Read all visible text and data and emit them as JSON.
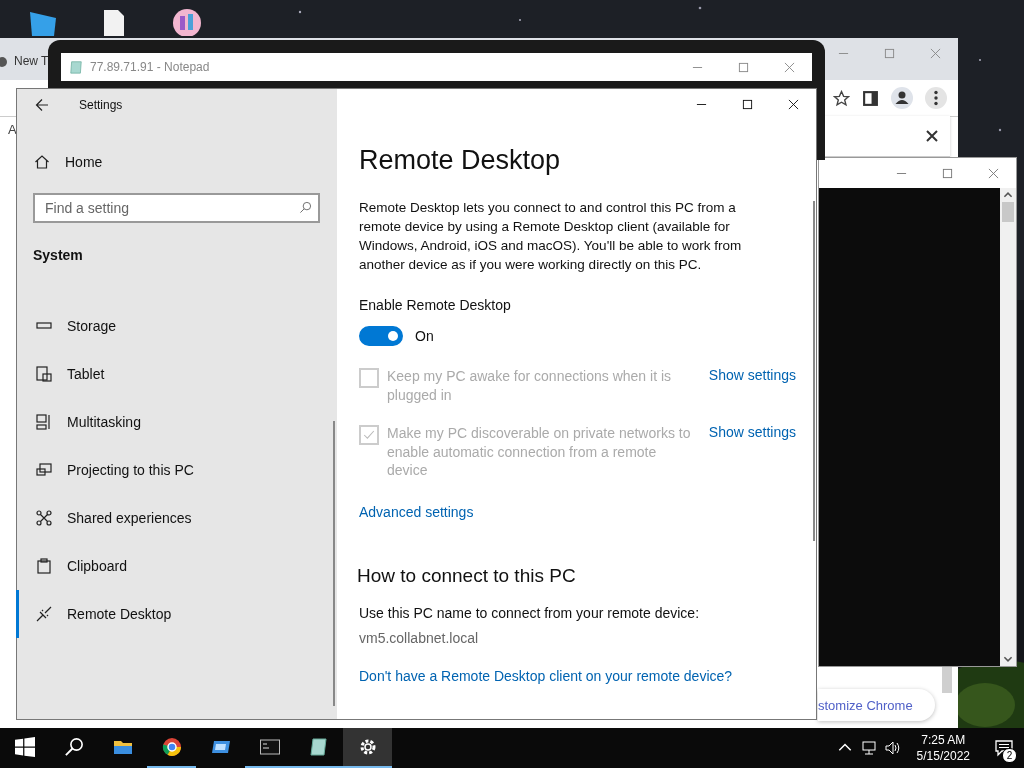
{
  "chrome_window": {
    "tab_title": "New T",
    "page_letter": "A",
    "customize_button": "stomize Chrome"
  },
  "notepad_window": {
    "title": "77.89.71.91 - Notepad"
  },
  "settings": {
    "title": "Settings",
    "home": "Home",
    "search": {
      "placeholder": "Find a setting"
    },
    "section": "System",
    "nav": [
      {
        "label": "Storage",
        "selected": false
      },
      {
        "label": "Tablet",
        "selected": false
      },
      {
        "label": "Multitasking",
        "selected": false
      },
      {
        "label": "Projecting to this PC",
        "selected": false
      },
      {
        "label": "Shared experiences",
        "selected": false
      },
      {
        "label": "Clipboard",
        "selected": false
      },
      {
        "label": "Remote Desktop",
        "selected": true
      }
    ],
    "page": {
      "title": "Remote Desktop",
      "description": "Remote Desktop lets you connect to and control this PC from a remote device by using a Remote Desktop client (available for Windows, Android, iOS and macOS). You'll be able to work from another device as if you were working directly on this PC.",
      "enable_label": "Enable Remote Desktop",
      "toggle": {
        "on": true,
        "label": "On"
      },
      "options": [
        {
          "label": "Keep my PC awake for connections when it is plugged in",
          "checked": false,
          "disabled": true,
          "link": "Show settings"
        },
        {
          "label": "Make my PC discoverable on private networks to enable automatic connection from a remote device",
          "checked": true,
          "disabled": true,
          "link": "Show settings"
        }
      ],
      "advanced_link": "Advanced settings",
      "connect_heading": "How to connect to this PC",
      "connect_text": "Use this PC name to connect from your remote device:",
      "pc_name": "vm5.collabnet.local",
      "client_link": "Don't have a Remote Desktop client on your remote device?"
    }
  },
  "taskbar": {
    "apps": [
      {
        "running": false,
        "selected": false
      },
      {
        "running": true,
        "selected": false
      },
      {
        "running": false,
        "selected": false
      },
      {
        "running": true,
        "selected": false
      },
      {
        "running": true,
        "selected": false
      },
      {
        "running": true,
        "selected": true
      }
    ],
    "clock": {
      "time": "7:25 AM",
      "date": "5/15/2022"
    },
    "notifications": "2"
  }
}
